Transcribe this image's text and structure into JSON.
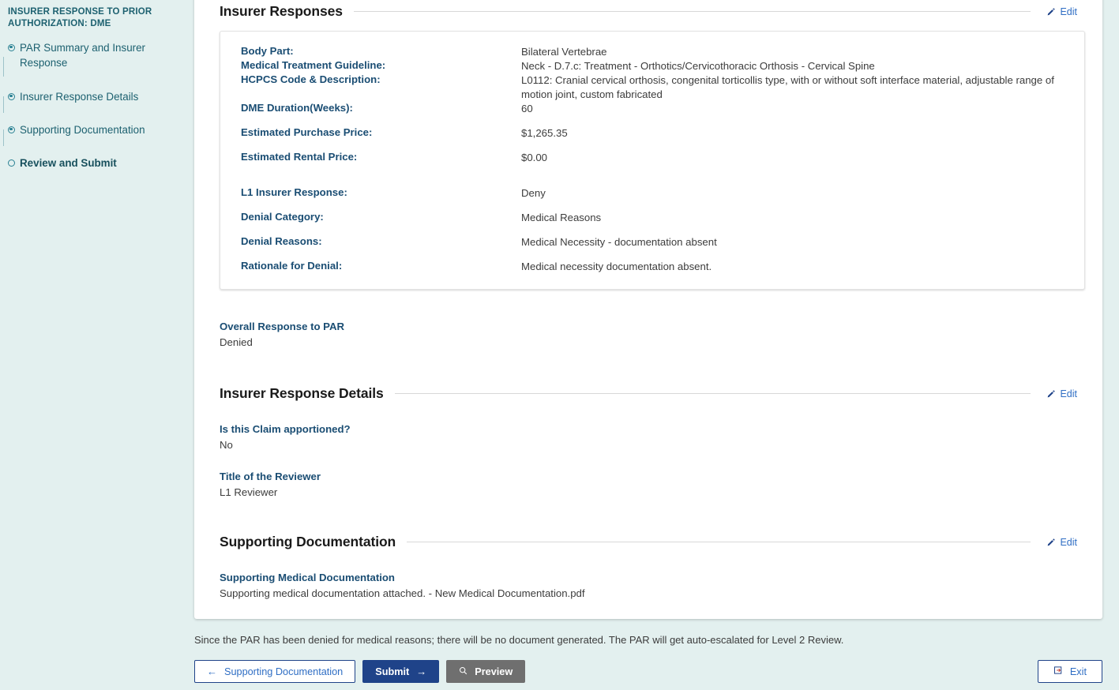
{
  "sidebar": {
    "title": "INSURER RESPONSE TO PRIOR AUTHORIZATION: DME",
    "steps": [
      {
        "label": "PAR Summary and Insurer Response",
        "state": "complete",
        "marker_icon": "step-dot-filled-icon"
      },
      {
        "label": "Insurer Response Details",
        "state": "complete",
        "marker_icon": "step-dot-filled-icon"
      },
      {
        "label": "Supporting Documentation",
        "state": "complete",
        "marker_icon": "step-dot-filled-icon"
      },
      {
        "label": "Review and Submit",
        "state": "current",
        "marker_icon": "step-dot-hollow-icon"
      }
    ]
  },
  "sections": {
    "insurer_responses": {
      "heading": "Insurer Responses",
      "edit_label": "Edit",
      "rows": [
        {
          "label": "Body Part:",
          "value": "Bilateral Vertebrae"
        },
        {
          "label": "Medical Treatment Guideline:",
          "value": "Neck - D.7.c: Treatment - Orthotics/Cervicothoracic Orthosis - Cervical Spine"
        },
        {
          "label": "HCPCS Code & Description:",
          "value": "L0112: Cranial cervical orthosis, congenital torticollis type, with or without soft interface material, adjustable range of motion joint, custom fabricated"
        },
        {
          "label": "DME Duration(Weeks):",
          "value": "60"
        },
        {
          "label": "Estimated Purchase Price:",
          "value": "$1,265.35"
        },
        {
          "label": "Estimated Rental Price:",
          "value": "$0.00"
        },
        {
          "label": "L1 Insurer Response:",
          "value": "Deny"
        },
        {
          "label": "Denial Category:",
          "value": "Medical Reasons"
        },
        {
          "label": "Denial Reasons:",
          "value": "Medical Necessity - documentation absent"
        },
        {
          "label": "Rationale for Denial:",
          "value": "Medical necessity documentation absent."
        }
      ]
    },
    "overall_response": {
      "label": "Overall Response to PAR",
      "value": "Denied"
    },
    "insurer_response_details": {
      "heading": "Insurer Response Details",
      "edit_label": "Edit",
      "fields": [
        {
          "label": "Is this Claim apportioned?",
          "value": "No"
        },
        {
          "label": "Title of the Reviewer",
          "value": "L1 Reviewer"
        }
      ]
    },
    "supporting_documentation": {
      "heading": "Supporting Documentation",
      "edit_label": "Edit",
      "fields": [
        {
          "label": "Supporting Medical Documentation",
          "value": "Supporting medical documentation attached. - New Medical Documentation.pdf"
        }
      ]
    }
  },
  "footer": {
    "note": "Since the PAR has been denied for medical reasons; there will be no document generated. The PAR will get auto-escalated for Level 2 Review.",
    "buttons": {
      "back": {
        "label": "Supporting Documentation",
        "icon": "arrow-left-icon"
      },
      "submit": {
        "label": "Submit",
        "icon": "arrow-right-icon"
      },
      "preview": {
        "label": "Preview",
        "icon": "search-icon"
      },
      "exit": {
        "label": "Exit",
        "icon": "exit-icon"
      }
    }
  },
  "colors": {
    "page_background": "#e3f0ef",
    "panel_background": "#ffffff",
    "sidebar_text": "#1d6170",
    "label_text": "#1a4d73",
    "link_blue": "#2f6ec4",
    "primary_button": "#1f4389",
    "gray_button": "#6f6f6f"
  }
}
